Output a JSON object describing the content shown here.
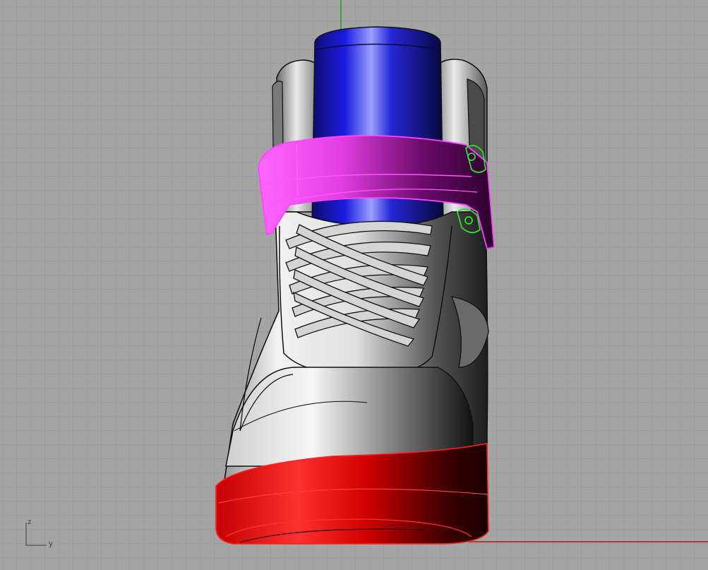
{
  "viewport": {
    "view": "Front",
    "axes": {
      "z_label": "z",
      "y_label": "y"
    },
    "colors": {
      "background": "#a4a4a4",
      "grid_minor": "#999999",
      "grid_major": "#8c8c8c",
      "world_axis_x": "#b30000",
      "world_axis_z": "#00a000",
      "strap_selected": "#e040e0",
      "tongue": "#1a1acc",
      "sole": "#dd0000",
      "upper": "#d8d8d8",
      "buckle": "#33dd33"
    }
  },
  "objects": [
    {
      "name": "tongue",
      "color": "blue"
    },
    {
      "name": "strap",
      "color": "magenta",
      "selected": true
    },
    {
      "name": "upper",
      "color": "gray"
    },
    {
      "name": "laces",
      "color": "gray"
    },
    {
      "name": "sole",
      "color": "red"
    },
    {
      "name": "buckle",
      "color": "green"
    }
  ]
}
